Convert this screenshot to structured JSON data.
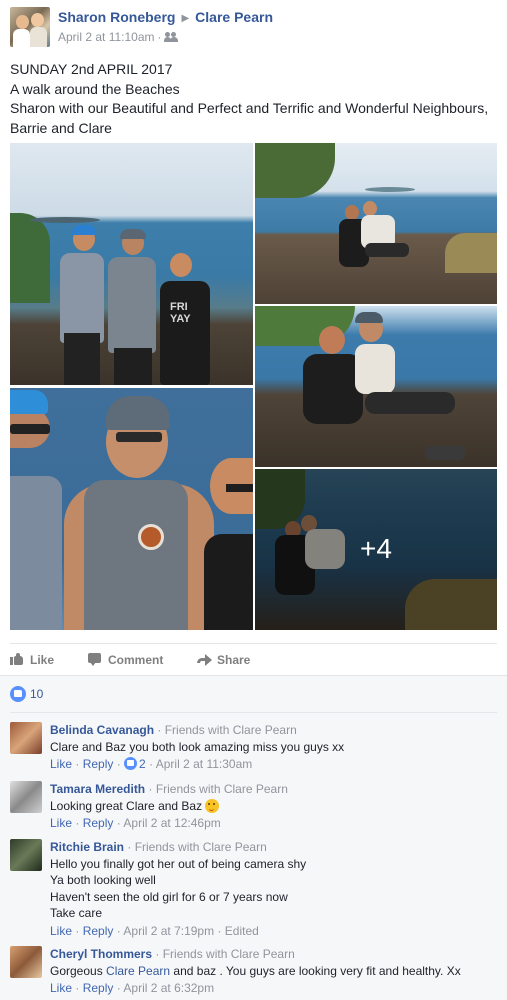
{
  "post": {
    "author": "Sharon Roneberg",
    "target": "Clare Pearn",
    "timestamp": "April 2 at 11:10am",
    "audience_icon": "friends-icon",
    "lines": [
      "SUNDAY 2nd APRIL 2017",
      "A walk around the Beaches",
      "Sharon with our Beautiful and Perfect and Terrific and Wonderful Neighbours,",
      "Barrie and Clare"
    ],
    "shirt_text": [
      "FRI",
      "YAY"
    ],
    "more_photos": "+4"
  },
  "actions": {
    "like": "Like",
    "comment": "Comment",
    "share": "Share"
  },
  "reactions": {
    "count": "10"
  },
  "comments": [
    {
      "name": "Belinda Cavanagh",
      "relation": "Friends with Clare Pearn",
      "lines": [
        "Clare and Baz you both look amazing miss you guys xx"
      ],
      "like": "Like",
      "reply": "Reply",
      "likes": "2",
      "time": "April 2 at 11:30am",
      "edited": ""
    },
    {
      "name": "Tamara Meredith",
      "relation": "Friends with Clare Pearn",
      "lines": [
        "Looking great Clare and Baz"
      ],
      "like": "Like",
      "reply": "Reply",
      "time": "April 2 at 12:46pm",
      "edited": ""
    },
    {
      "name": "Ritchie Brain",
      "relation": "Friends with Clare Pearn",
      "lines": [
        "Hello you finally got her out of being camera shy",
        "Ya both looking well",
        "Haven't seen the old girl for 6 or 7 years now",
        "Take care"
      ],
      "like": "Like",
      "reply": "Reply",
      "time": "April 2 at 7:19pm",
      "edited": "Edited"
    },
    {
      "name": "Cheryl Thommers",
      "relation": "Friends with Clare Pearn",
      "text_before": "Gorgeous ",
      "mention": "Clare Pearn",
      "text_after": " and baz . You guys are looking very fit and healthy. Xx",
      "like": "Like",
      "reply": "Reply",
      "time": "April 2 at 6:32pm",
      "edited": ""
    }
  ],
  "separator": "·",
  "colors": {
    "link": "#365899",
    "muted": "#90949c",
    "like_blue": "#5890ff",
    "comment_bg": "#f6f7f9"
  }
}
